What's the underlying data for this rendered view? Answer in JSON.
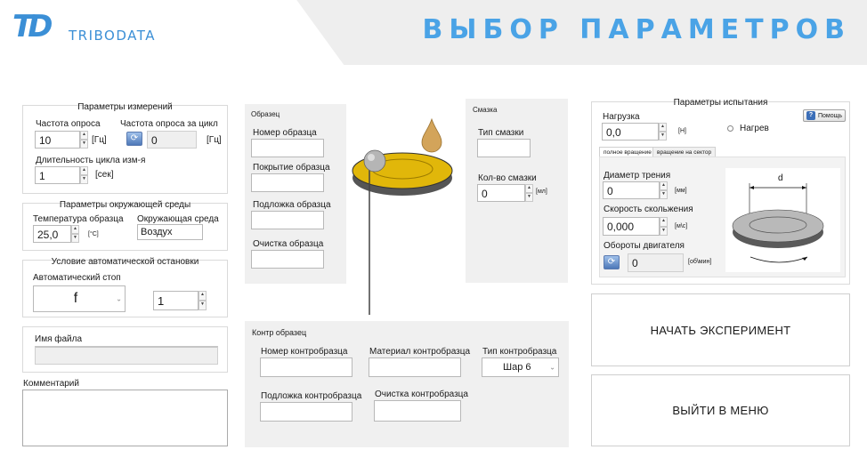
{
  "header": {
    "logo_mark": "TD",
    "logo_text": "TRIBODATA",
    "title": "ВЫБОР ПАРАМЕТРОВ"
  },
  "measurement": {
    "title": "Параметры измерений",
    "freq_label": "Частота опроса",
    "freq_value": "10",
    "freq_unit": "[Гц]",
    "freq_cycle_label": "Частота опроса за цикл",
    "freq_cycle_value": "0",
    "freq_cycle_unit": "[Гц]",
    "duration_label": "Длительность цикла изм-я",
    "duration_value": "1",
    "duration_unit": "[сек]"
  },
  "environment": {
    "title": "Параметры окружающей среды",
    "temp_label": "Температура образца",
    "temp_value": "25,0",
    "temp_unit": "[°С]",
    "env_label": "Окружающая среда",
    "env_value": "Воздух"
  },
  "autostop": {
    "title": "Условие автоматической остановки",
    "stop_label": "Автоматический стоп",
    "stop_value": "f",
    "stop_count": "1"
  },
  "file": {
    "label": "Имя файла",
    "value": ""
  },
  "comment": {
    "label": "Комментарий",
    "value": ""
  },
  "sample": {
    "title": "Образец",
    "number_label": "Номер образца",
    "coating_label": "Покрытие образца",
    "substrate_label": "Подложка образца",
    "cleaning_label": "Очистка образца"
  },
  "lubricant": {
    "title": "Смазка",
    "type_label": "Тип смазки",
    "amount_label": "Кол-во смазки",
    "amount_value": "0",
    "amount_unit": "[мл]"
  },
  "counter": {
    "title": "Контр образец",
    "number_label": "Номер контробразца",
    "material_label": "Материал контробразца",
    "type_label": "Тип контробразца",
    "type_value": "Шар 6",
    "substrate_label": "Подложка контробразца",
    "cleaning_label": "Очистка контробразца"
  },
  "test": {
    "title": "Параметры испытания",
    "load_label": "Нагрузка",
    "load_value": "0,0",
    "load_unit": "[Н]",
    "help_label": "Помощь",
    "heating_label": "Нагрев",
    "tab_full": "полное вращение",
    "tab_sector": "вращение на сектор",
    "diameter_label": "Диаметр трения",
    "diameter_value": "0",
    "diameter_unit": "[мм]",
    "speed_label": "Скорость скольжения",
    "speed_value": "0,000",
    "speed_unit": "[м\\с]",
    "rpm_label": "Обороты двигателя",
    "rpm_value": "0",
    "rpm_unit": "[об\\мин]",
    "disk_label": "d"
  },
  "actions": {
    "start_label": "НАЧАТЬ ЭКСПЕРИМЕНТ",
    "exit_label": "ВЫЙТИ В МЕНЮ"
  },
  "colors": {
    "accent": "#4aa3e6",
    "disk_gold": "#e1b70a",
    "disk_base": "#555555"
  }
}
